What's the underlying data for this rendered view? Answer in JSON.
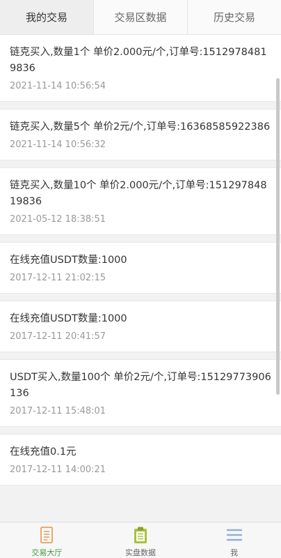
{
  "tabs": [
    {
      "label": "我的交易",
      "active": true
    },
    {
      "label": "交易区数据",
      "active": false
    },
    {
      "label": "历史交易",
      "active": false
    }
  ],
  "records": [
    {
      "title": "链克买入,数量1个 单价2.000元/个,订单号:15129784819836",
      "time": "2021-11-14 10:56:54"
    },
    {
      "title": "链克买入,数量5个 单价2元/个,订单号:16368585922386",
      "time": "2021-11-14 10:56:32"
    },
    {
      "title": "链克买入,数量10个 单价2.000元/个,订单号:15129784819836",
      "time": "2021-05-12 18:38:51"
    },
    {
      "title": "在线充值USDT数量:1000",
      "time": "2017-12-11 21:02:15"
    },
    {
      "title": "在线充值USDT数量:1000",
      "time": "2017-12-11 20:41:57"
    },
    {
      "title": "USDT买入,数量100个 单价2元/个,订单号:15129773906136",
      "time": "2017-12-11 15:48:01"
    },
    {
      "title": "在线充值0.1元",
      "time": "2017-12-11 14:00:21"
    }
  ],
  "bottom_nav": [
    {
      "label": "交易大厅",
      "icon": "document-icon",
      "active": true
    },
    {
      "label": "实盘数据",
      "icon": "clipboard-icon",
      "active": false
    },
    {
      "label": "我",
      "icon": "menu-icon",
      "active": false
    }
  ],
  "colors": {
    "active_nav": "#3c9a3c",
    "icon_orange": "#e8a05c",
    "icon_green": "#a9c23a",
    "icon_blue": "#8fb0d8"
  }
}
